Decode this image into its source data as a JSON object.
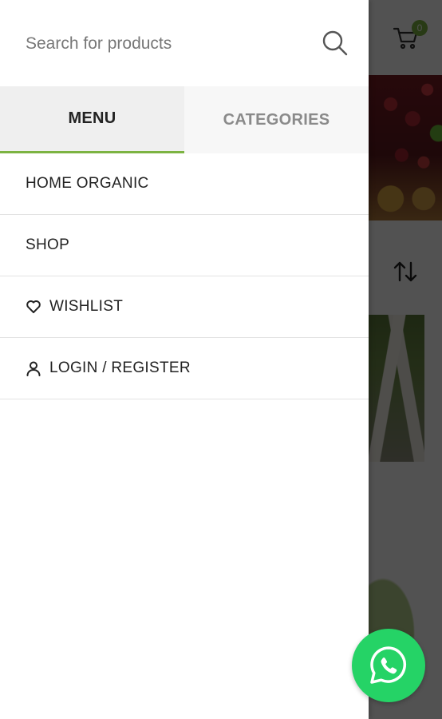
{
  "search": {
    "placeholder": "Search for products"
  },
  "tabs": [
    {
      "label": "MENU",
      "active": true
    },
    {
      "label": "CATEGORIES",
      "active": false
    }
  ],
  "menu": {
    "items": [
      {
        "label": "HOME ORGANIC",
        "icon": null
      },
      {
        "label": "SHOP",
        "icon": null
      },
      {
        "label": "WISHLIST",
        "icon": "heart-icon"
      },
      {
        "label": "LOGIN / REGISTER",
        "icon": "user-icon"
      }
    ]
  },
  "cart": {
    "count": "0"
  },
  "colors": {
    "accent": "#7cb342",
    "whatsapp": "#25d366",
    "overlay": "rgba(0,0,0,0.68)"
  }
}
